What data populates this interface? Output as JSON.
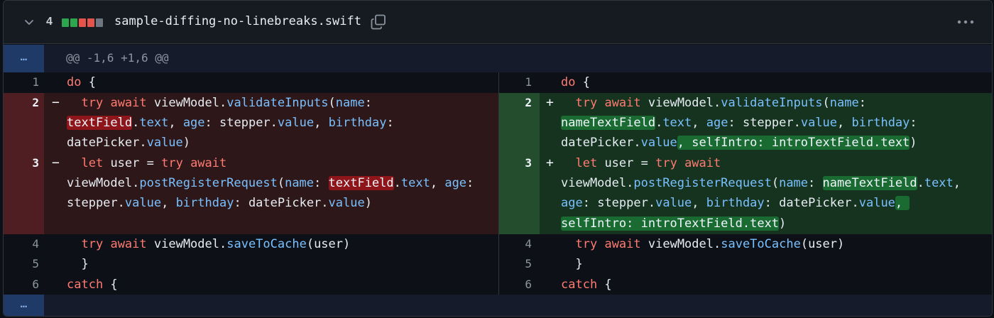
{
  "header": {
    "changes_count": "4",
    "diffstat_colors": [
      "#2da44e",
      "#2da44e",
      "#e5534b",
      "#e5534b",
      "#6e7681"
    ],
    "filename": "sample-diffing-no-linebreaks.swift",
    "icons": [
      "chevron-down-icon",
      "copy-icon",
      "kebab-horizontal-icon"
    ]
  },
  "hunk": {
    "expand_label": "…",
    "header": "@@ -1,6 +1,6 @@"
  },
  "bottom": {
    "expand_label": "…"
  },
  "left": {
    "line_numbers": [
      "1",
      "2",
      "3",
      "4",
      "5",
      "6"
    ],
    "signs": [
      "−",
      "−"
    ]
  },
  "right": {
    "line_numbers": [
      "1",
      "2",
      "3",
      "4",
      "5",
      "6"
    ],
    "signs": [
      "+",
      "+"
    ]
  },
  "tokens": {
    "do": "do",
    "brace_open": " {",
    "try": "try",
    "await": "await",
    "let": "let",
    "catch": "catch",
    "brace_close": "}",
    "view_model": " viewModel.",
    "view_model_nl": "viewModel.",
    "validate_inputs": "validateInputs",
    "post_register": "postRegisterRequest",
    "save_to_cache": "saveToCache",
    "save_args": "(user)",
    "name": "name",
    "text": "text",
    "age": "age",
    "value": "value",
    "birthday": "birthday",
    "stepper": "stepper.",
    "date_picker": "datePicker.",
    "text_field": "textField",
    "name_text_field": "nameTextField",
    "self_intro_line2": ", selfIntro: introTextField.text",
    "self_intro_line3_a": ", ",
    "self_intro_line3_b": "selfIntro: introTextField.text",
    "user_eq": " user = ",
    "open_paren": "(",
    "close_paren": ")",
    "colon_sp": ": ",
    "colon": ":",
    "dot": ".",
    "comma_sp": ", "
  }
}
